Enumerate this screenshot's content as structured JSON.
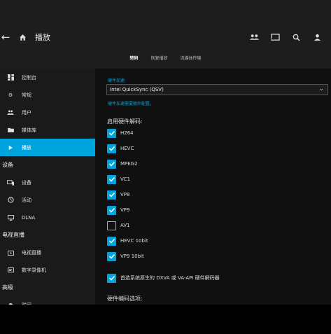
{
  "header": {
    "title": "播放",
    "icons": [
      "back-arrow-icon",
      "home-icon",
      "users-icon",
      "cast-icon",
      "search-icon",
      "user-icon"
    ],
    "tabs": [
      {
        "label": "转码",
        "active": true
      },
      {
        "label": "恢复播放",
        "active": false
      },
      {
        "label": "流媒体传输",
        "active": false
      }
    ]
  },
  "sidebar": {
    "items_top": [
      {
        "label": "控制台",
        "icon": "dashboard-icon"
      },
      {
        "label": "常规",
        "icon": "gear-icon"
      },
      {
        "label": "用户",
        "icon": "users-icon"
      },
      {
        "label": "媒体库",
        "icon": "folder-icon"
      },
      {
        "label": "播放",
        "icon": "play-icon",
        "active": true
      }
    ],
    "section_devices": "设备",
    "items_devices": [
      {
        "label": "设备",
        "icon": "devices-icon"
      },
      {
        "label": "活动",
        "icon": "activity-icon"
      },
      {
        "label": "DLNA",
        "icon": "dlna-icon"
      }
    ],
    "section_livetv": "电视直播",
    "items_livetv": [
      {
        "label": "电视直播",
        "icon": "live-tv-icon"
      },
      {
        "label": "数字录像机",
        "icon": "dvr-icon"
      }
    ],
    "section_advanced": "高级",
    "items_advanced": [
      {
        "label": "联网",
        "icon": "cloud-icon"
      }
    ]
  },
  "main": {
    "accel_label": "硬件加速:",
    "accel_value": "Intel QuickSync (QSV)",
    "accel_hint": "硬件加速需要额外配置。",
    "decode_title": "启用硬件解码:",
    "codecs": [
      {
        "label": "H264",
        "checked": true
      },
      {
        "label": "HEVC",
        "checked": true
      },
      {
        "label": "MPEG2",
        "checked": true
      },
      {
        "label": "VC1",
        "checked": true
      },
      {
        "label": "VP8",
        "checked": true
      },
      {
        "label": "VP9",
        "checked": true
      },
      {
        "label": "AV1",
        "checked": false
      },
      {
        "label": "HEVC 10bit",
        "checked": true
      },
      {
        "label": "VP9 10bit",
        "checked": true
      }
    ],
    "prefer_native": {
      "label": "首选系统原生的 DXVA 或 VA-API 硬件解码器",
      "checked": true
    },
    "encode_title": "硬件编码选项:"
  },
  "colors": {
    "accent": "#00a4dc",
    "header_bg": "#1d1d1d",
    "sidebar_bg": "#1a1a1a",
    "main_bg": "#101010"
  }
}
